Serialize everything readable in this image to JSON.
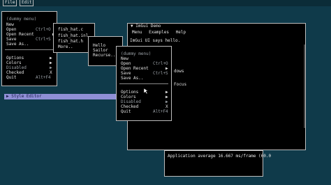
{
  "menubar": {
    "items": [
      "File",
      "Edit"
    ]
  },
  "dummy_menu_1": {
    "title": "(dummy menu)",
    "items": [
      {
        "label": "New"
      },
      {
        "label": "Open",
        "shortcut": "Ctrl+O"
      },
      {
        "label": "Open Recent",
        "arrow": "▶"
      },
      {
        "label": "Save",
        "shortcut": "Ctrl+S"
      },
      {
        "label": "Save As.."
      },
      {
        "label": "Options",
        "arrow": "▶"
      },
      {
        "label": "Colors",
        "arrow": "▶"
      },
      {
        "label": "Disabled",
        "arrow": "▶"
      },
      {
        "label": "Checked",
        "arrow": "X"
      },
      {
        "label": "Quit",
        "shortcut": "Alt+F4"
      }
    ]
  },
  "recent_files": {
    "items": [
      "fish_hat.c",
      "fish_hat.inl",
      "fish_hat.h",
      "More.."
    ]
  },
  "more_menu": {
    "items": [
      "Hello",
      "Sailor",
      "Recurse.."
    ]
  },
  "dummy_menu_2": {
    "title": "(dummy menu)",
    "items": [
      {
        "label": "New"
      },
      {
        "label": "Open",
        "shortcut": "Ctrl+O"
      },
      {
        "label": "Open Recent",
        "arrow": "▶"
      },
      {
        "label": "Save",
        "shortcut": "Ctrl+S"
      },
      {
        "label": "Save As.."
      },
      {
        "label": "Options",
        "arrow": "▶"
      },
      {
        "label": "Colors",
        "arrow": "▶"
      },
      {
        "label": "Disabled",
        "arrow": "▶"
      },
      {
        "label": "Checked",
        "arrow": "X"
      },
      {
        "label": "Quit",
        "shortcut": "Alt+F4"
      }
    ]
  },
  "demo_window": {
    "title": "ImGui Demo",
    "menu": [
      "Menu",
      "Examples",
      "Help"
    ],
    "greeting": "ImGui UI says hello.",
    "partial_1": "dows",
    "partial_2": "Focus"
  },
  "style_editor": {
    "title": "Style Editor"
  },
  "log": {
    "text": "Application average 16.667 ms/frame (60.0"
  }
}
